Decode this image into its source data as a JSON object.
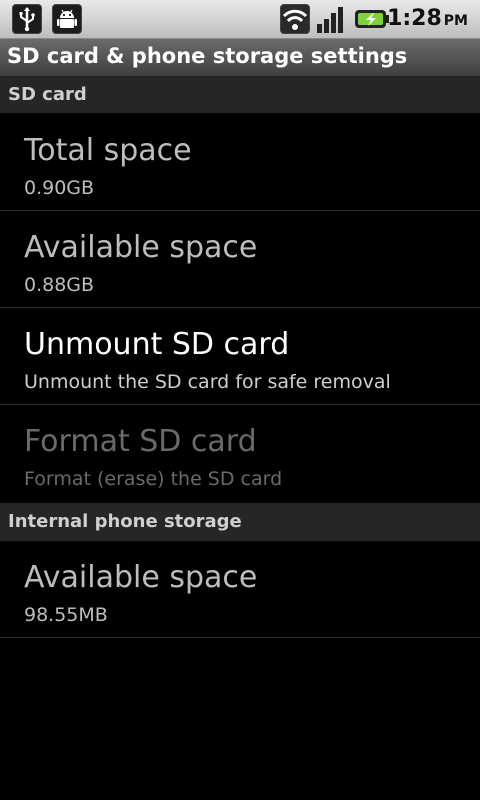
{
  "status_bar": {
    "time": "1:28",
    "ampm": "PM",
    "icons": [
      "usb-icon",
      "android-debug-icon",
      "wifi-icon",
      "signal-icon",
      "battery-charging-icon"
    ]
  },
  "title": "SD card & phone storage settings",
  "sections": {
    "sd_card": {
      "header": "SD card",
      "items": [
        {
          "title": "Total space",
          "summary": "0.90GB"
        },
        {
          "title": "Available space",
          "summary": "0.88GB"
        },
        {
          "title": "Unmount SD card",
          "summary": "Unmount the SD card for safe removal"
        },
        {
          "title": "Format SD card",
          "summary": "Format (erase) the SD card"
        }
      ]
    },
    "internal": {
      "header": "Internal phone storage",
      "items": [
        {
          "title": "Available space",
          "summary": "98.55MB"
        }
      ]
    }
  }
}
